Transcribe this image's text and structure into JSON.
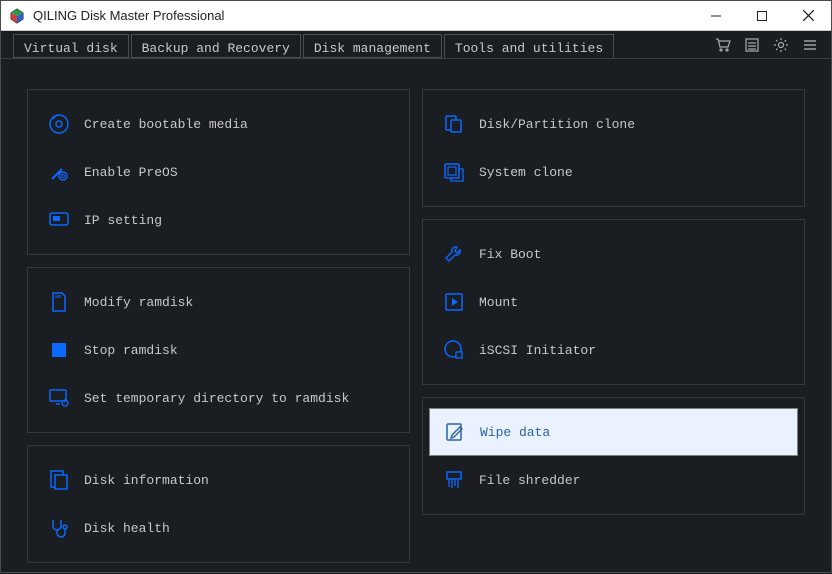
{
  "window": {
    "title": "QILING Disk Master Professional"
  },
  "tabs": {
    "virtual_disk": "Virtual disk",
    "backup_recovery": "Backup and Recovery",
    "disk_management": "Disk management",
    "tools_utilities": "Tools and utilities"
  },
  "left_groups": [
    {
      "items": [
        {
          "id": "create-bootable-media",
          "label": "Create bootable media",
          "icon": "disc-icon"
        },
        {
          "id": "enable-preos",
          "label": "Enable PreOS",
          "icon": "tool-gear-icon"
        },
        {
          "id": "ip-setting",
          "label": "IP setting",
          "icon": "monitor-icon"
        }
      ]
    },
    {
      "items": [
        {
          "id": "modify-ramdisk",
          "label": "Modify ramdisk",
          "icon": "sd-card-icon"
        },
        {
          "id": "stop-ramdisk",
          "label": "Stop ramdisk",
          "icon": "stop-icon"
        },
        {
          "id": "set-temp-dir-ramdisk",
          "label": "Set temporary directory to ramdisk",
          "icon": "monitor-gear-icon"
        }
      ]
    },
    {
      "items": [
        {
          "id": "disk-information",
          "label": "Disk information",
          "icon": "doc-icon"
        },
        {
          "id": "disk-health",
          "label": "Disk health",
          "icon": "stethoscope-icon"
        }
      ]
    }
  ],
  "right_groups": [
    {
      "items": [
        {
          "id": "disk-partition-clone",
          "label": "Disk/Partition clone",
          "icon": "clone-icon"
        },
        {
          "id": "system-clone",
          "label": "System clone",
          "icon": "system-clone-icon"
        }
      ]
    },
    {
      "items": [
        {
          "id": "fix-boot",
          "label": "Fix Boot",
          "icon": "wrench-icon"
        },
        {
          "id": "mount",
          "label": "Mount",
          "icon": "play-icon"
        },
        {
          "id": "iscsi-initiator",
          "label": "iSCSI Initiator",
          "icon": "circle-connect-icon"
        }
      ]
    },
    {
      "items": [
        {
          "id": "wipe-data",
          "label": "Wipe data",
          "icon": "edit-icon",
          "selected": true
        },
        {
          "id": "file-shredder",
          "label": "File shredder",
          "icon": "shredder-icon"
        }
      ]
    }
  ],
  "colors": {
    "accent": "#0b69ff",
    "panel_border": "#35383c",
    "selected_bg": "#e9f2fe"
  }
}
